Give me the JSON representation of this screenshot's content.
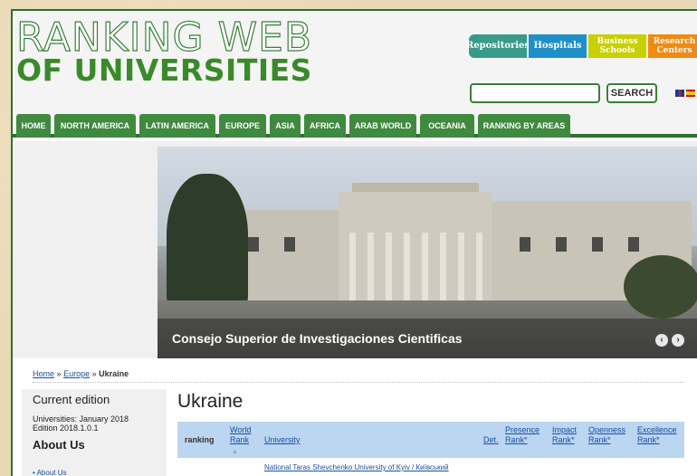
{
  "header": {
    "logo_line1": "RANKING WEB",
    "logo_line2": "OF UNIVERSITIES",
    "categories": [
      "Repositories",
      "Hospitals",
      "Business Schools",
      "Research Centers"
    ],
    "search_label": "SEARCH",
    "search_value": ""
  },
  "nav": {
    "items": [
      "HOME",
      "NORTH AMERICA",
      "LATIN AMERICA",
      "EUROPE",
      "ASIA",
      "AFRICA",
      "ARAB WORLD",
      "OCEANIA",
      "RANKING BY AREAS"
    ]
  },
  "banner": {
    "caption": "Consejo Superior de Investigaciones Cientificas",
    "prev": "‹",
    "next": "›"
  },
  "breadcrumb": {
    "home": "Home",
    "sep1": "»",
    "europe": "Europe",
    "sep2": "»",
    "current": "Ukraine"
  },
  "sidebar": {
    "current_edition_title": "Current edition",
    "edition_line1": "Universities: January 2018",
    "edition_line2": "Edition 2018.1.0.1",
    "about_title": "About Us",
    "about_link": "About Us"
  },
  "main": {
    "title": "Ukraine",
    "columns": {
      "ranking": "ranking",
      "world_rank": "World Rank",
      "university": "University",
      "det": "Det.",
      "presence": "Presence Rank*",
      "impact": "Impact Rank*",
      "openness": "Openness Rank*",
      "excellence": "Excellence Rank*"
    },
    "first_row_university": "National Taras Shevchenko University of Kyiv / Київський"
  },
  "colors": {
    "brand_green": "#3f8a3f",
    "repositories": "#3a9a8a",
    "hospitals": "#1f8fc8",
    "business": "#c8d000",
    "research": "#f08a10",
    "table_header": "#bcd5f0"
  }
}
